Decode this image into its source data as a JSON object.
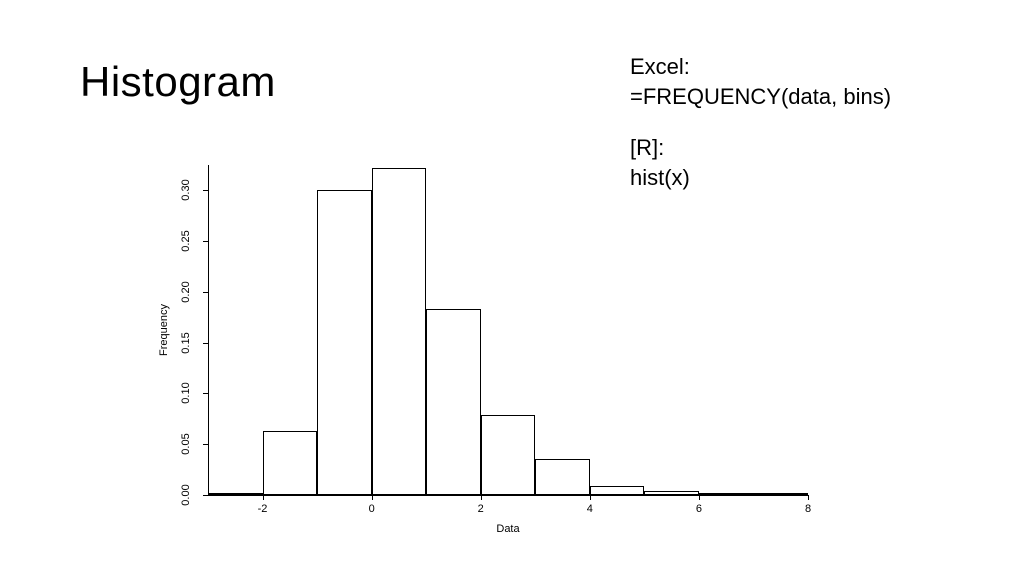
{
  "title": "Histogram",
  "annotations": {
    "excel_label": "Excel:",
    "excel_formula": "=FREQUENCY(data, bins)",
    "r_label": "[R]:",
    "r_code": "hist(x)"
  },
  "chart_data": {
    "type": "bar",
    "title": "",
    "xlabel": "Data",
    "ylabel": "Frequency",
    "xlim": [
      -3,
      8
    ],
    "ylim": [
      0,
      0.325
    ],
    "x_ticks": [
      -2,
      0,
      2,
      4,
      6,
      8
    ],
    "y_ticks": [
      0.0,
      0.05,
      0.1,
      0.15,
      0.2,
      0.25,
      0.3
    ],
    "y_tick_labels": [
      "0.00",
      "0.05",
      "0.10",
      "0.15",
      "0.20",
      "0.25",
      "0.30"
    ],
    "bins": [
      {
        "x0": -3,
        "x1": -2,
        "value": 0.002
      },
      {
        "x0": -2,
        "x1": -1,
        "value": 0.063
      },
      {
        "x0": -1,
        "x1": 0,
        "value": 0.3
      },
      {
        "x0": 0,
        "x1": 1,
        "value": 0.322
      },
      {
        "x0": 1,
        "x1": 2,
        "value": 0.183
      },
      {
        "x0": 2,
        "x1": 3,
        "value": 0.079
      },
      {
        "x0": 3,
        "x1": 4,
        "value": 0.035
      },
      {
        "x0": 4,
        "x1": 5,
        "value": 0.009
      },
      {
        "x0": 5,
        "x1": 6,
        "value": 0.004
      },
      {
        "x0": 6,
        "x1": 7,
        "value": 0.002
      },
      {
        "x0": 7,
        "x1": 8,
        "value": 0.001
      }
    ]
  }
}
